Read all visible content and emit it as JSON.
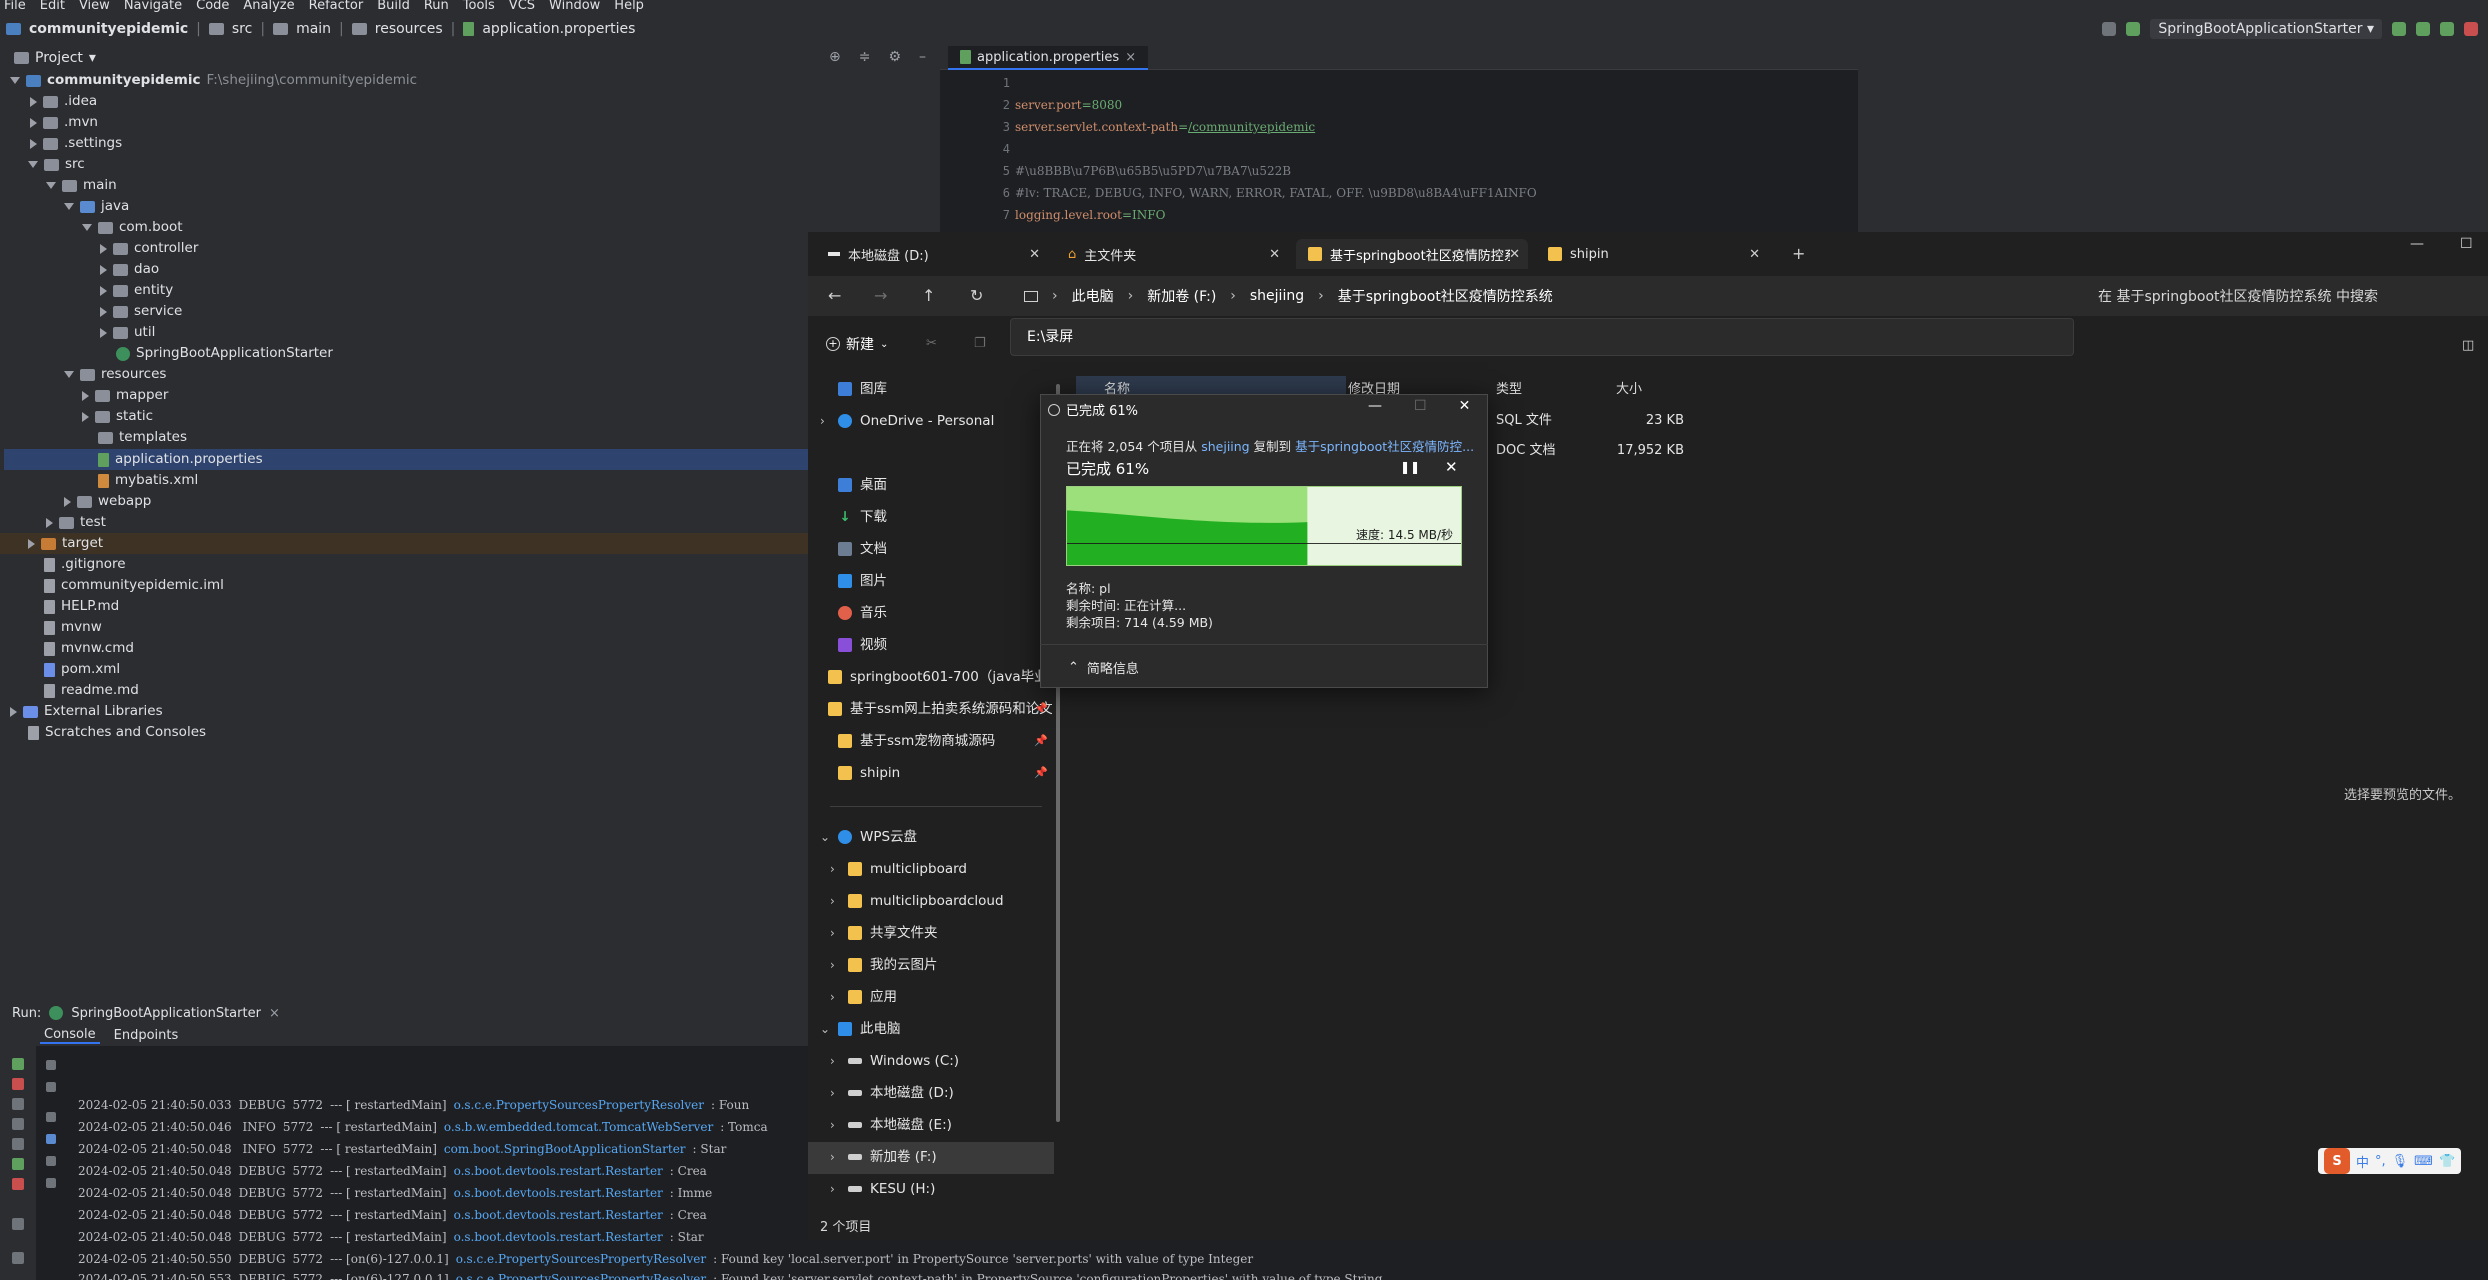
{
  "ide": {
    "menu": [
      "File",
      "Edit",
      "View",
      "Navigate",
      "Code",
      "Analyze",
      "Refactor",
      "Build",
      "Run",
      "Tools",
      "VCS",
      "Window",
      "Help"
    ],
    "breadcrumb": [
      "communityepidemic",
      "src",
      "main",
      "resources",
      "application.properties"
    ],
    "run_config": "SpringBootApplicationStarter",
    "project": {
      "header": "Project",
      "root_name": "communityepidemic",
      "root_path": "F:\\shejiing\\communityepidemic",
      "items": [
        ".idea",
        ".mvn",
        ".settings",
        "src",
        "main",
        "java",
        "com.boot",
        "controller",
        "dao",
        "entity",
        "service",
        "util",
        "SpringBootApplicationStarter",
        "resources",
        "mapper",
        "static",
        "templates",
        "application.properties",
        "mybatis.xml",
        "webapp",
        "test",
        "target",
        ".gitignore",
        "communityepidemic.iml",
        "HELP.md",
        "mvnw",
        "mvnw.cmd",
        "pom.xml",
        "readme.md",
        "External Libraries",
        "Scratches and Consoles"
      ]
    },
    "editor": {
      "tab": "application.properties",
      "line_numbers": [
        "1",
        "2",
        "3",
        "4",
        "5",
        "6",
        "7"
      ],
      "lines": {
        "l2_key": "server.port",
        "l2_val": "=8080",
        "l3_key": "server.servlet.context-path",
        "l3_eq": "=",
        "l3_val": "/communityepidemic",
        "l5": "#\\u8BBB\\u7P6B\\u65B5\\u5PD7\\u7BA7\\u522B",
        "l6": "#lv: TRACE, DEBUG, INFO, WARN, ERROR, FATAL, OFF. \\u9BD8\\u8BA4\\uFF1AINFO",
        "l7_key": "logging.level.root",
        "l7_val": "=INFO"
      }
    },
    "run": {
      "label": "Run:",
      "tab": "SpringBootApplicationStarter",
      "console_tab": "Console",
      "endpoints_tab": "Endpoints",
      "logs": [
        {
          "ts": "2024-02-05 21:40:50.033",
          "lvl": "DEBUG",
          "pid": "5772",
          "thread": "--- [  restartedMain]",
          "logger": "o.s.c.e.PropertySourcesPropertyResolver",
          "msg": ": Foun"
        },
        {
          "ts": "2024-02-05 21:40:50.046",
          "lvl": " INFO",
          "pid": "5772",
          "thread": "--- [  restartedMain]",
          "logger": "o.s.b.w.embedded.tomcat.TomcatWebServer",
          "msg": ": Tomca"
        },
        {
          "ts": "2024-02-05 21:40:50.048",
          "lvl": " INFO",
          "pid": "5772",
          "thread": "--- [  restartedMain]",
          "logger": "com.boot.SpringBootApplicationStarter",
          "msg": ": Star"
        },
        {
          "ts": "2024-02-05 21:40:50.048",
          "lvl": "DEBUG",
          "pid": "5772",
          "thread": "--- [  restartedMain]",
          "logger": "o.s.boot.devtools.restart.Restarter",
          "msg": ": Crea"
        },
        {
          "ts": "2024-02-05 21:40:50.048",
          "lvl": "DEBUG",
          "pid": "5772",
          "thread": "--- [  restartedMain]",
          "logger": "o.s.boot.devtools.restart.Restarter",
          "msg": ": Imme"
        },
        {
          "ts": "2024-02-05 21:40:50.048",
          "lvl": "DEBUG",
          "pid": "5772",
          "thread": "--- [  restartedMain]",
          "logger": "o.s.boot.devtools.restart.Restarter",
          "msg": ": Crea"
        },
        {
          "ts": "2024-02-05 21:40:50.048",
          "lvl": "DEBUG",
          "pid": "5772",
          "thread": "--- [  restartedMain]",
          "logger": "o.s.boot.devtools.restart.Restarter",
          "msg": ": Star"
        },
        {
          "ts": "2024-02-05 21:40:50.550",
          "lvl": "DEBUG",
          "pid": "5772",
          "thread": "--- [on(6)-127.0.0.1]",
          "logger": "o.s.c.e.PropertySourcesPropertyResolver",
          "msg": ": Found key 'local.server.port' in PropertySource 'server.ports' with value of type Integer"
        },
        {
          "ts": "2024-02-05 21:40:50.553",
          "lvl": "DEBUG",
          "pid": "5772",
          "thread": "--- [on(6)-127.0.0.1]",
          "logger": "o.s.c.e.PropertySourcesPropertyResolver",
          "msg": ": Found key 'server.servlet.context-path' in PropertySource 'configurationProperties' with value of type String"
        }
      ]
    }
  },
  "explorer": {
    "tabs": [
      "本地磁盘 (D:)",
      "主文件夹",
      "基于springboot社区疫情防控系",
      "shipin"
    ],
    "address": [
      "此电脑",
      "新加卷 (F:)",
      "shejiing",
      "基于springboot社区疫情防控系统"
    ],
    "search_placeholder": "在 基于springboot社区疫情防控系统 中搜索",
    "dropdown": "E:\\录屏",
    "new_button": "新建",
    "columns": {
      "name": "名称",
      "modified": "修改日期",
      "type": "类型",
      "size": "大小"
    },
    "files": [
      {
        "type": "SQL 文件",
        "size": "23 KB"
      },
      {
        "type": "DOC 文档",
        "size": "17,952 KB"
      }
    ],
    "nav": {
      "gallery": "图库",
      "onedrive": "OneDrive - Personal",
      "desktop": "桌面",
      "downloads": "下载",
      "documents": "文档",
      "pictures": "图片",
      "music": "音乐",
      "videos": "视频",
      "pinned": [
        "springboot601-700（java毕业设",
        "基于ssm网上拍卖系统源码和论文",
        "基于ssm宠物商城源码",
        "shipin"
      ],
      "wps": "WPS云盘",
      "wps_items": [
        "multiclipboard",
        "multiclipboardcloud",
        "共享文件夹",
        "我的云图片",
        "应用"
      ],
      "this_pc": "此电脑",
      "drives": [
        "Windows (C:)",
        "本地磁盘 (D:)",
        "本地磁盘 (E:)",
        "新加卷 (F:)",
        "KESU (H:)"
      ]
    },
    "status": "2 个项目",
    "preview": "选择要预览的文件。"
  },
  "dialog": {
    "title": "已完成 61%",
    "line_prefix": "正在将 2,054 个项目从 ",
    "line_src": "shejiing",
    "line_mid": " 复制到 ",
    "line_dst": "基于springboot社区疫情防控...",
    "percent": "已完成 61%",
    "progress": 0.61,
    "speed": "速度: 14.5 MB/秒",
    "name": "名称: pl",
    "time_left": "剩余时间: 正在计算...",
    "items_left": "剩余项目: 714 (4.59 MB)",
    "less_info": "简略信息"
  },
  "ime": {
    "mode": "中",
    "punct": "°,"
  },
  "colors": {
    "ide_bg": "#2b2d30",
    "editor_bg": "#1e1f22",
    "selection": "#2e436e",
    "explorer_bg": "#202020",
    "progress_green": "#22b022",
    "accent_blue": "#3574f0"
  }
}
